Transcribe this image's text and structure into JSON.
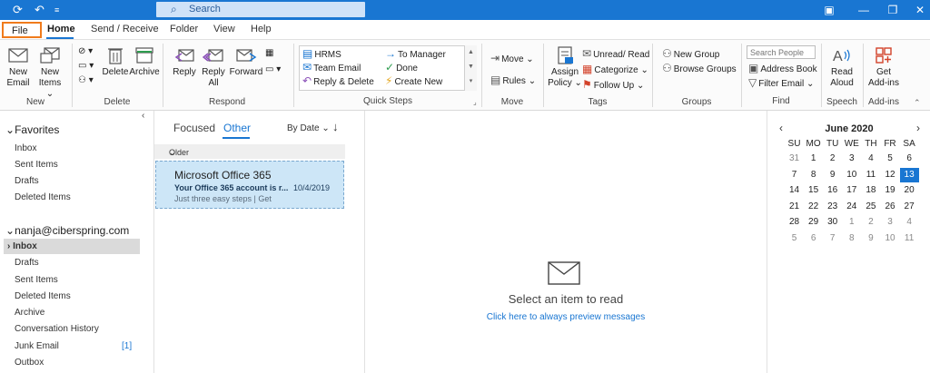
{
  "titlebar": {
    "search_label": "Search",
    "icons": [
      "sync-icon",
      "undo-icon",
      "customize-quick-access-icon",
      "search-icon",
      "ribbon-display-icon",
      "minimize-icon",
      "restore-icon",
      "close-icon"
    ]
  },
  "menu": {
    "tabs": [
      "File",
      "Home",
      "Send / Receive",
      "Folder",
      "View",
      "Help"
    ],
    "selected": "Home"
  },
  "ribbon": {
    "new": {
      "new_email": [
        "New",
        "Email"
      ],
      "new_items": [
        "New",
        "Items ⌄"
      ],
      "group": "New"
    },
    "delete": {
      "delete": "Delete",
      "archive": "Archive",
      "group": "Delete"
    },
    "respond": {
      "reply": "Reply",
      "reply_all": [
        "Reply",
        "All"
      ],
      "forward": "Forward",
      "group": "Respond"
    },
    "quick_steps": {
      "left": [
        "HRMS",
        "Team Email",
        "Reply & Delete"
      ],
      "right": [
        "To Manager",
        "Done",
        "Create New"
      ],
      "group": "Quick Steps"
    },
    "move": {
      "move": "Move ⌄",
      "rules": "Rules ⌄",
      "group": "Move"
    },
    "tags": {
      "assign_policy": [
        "Assign",
        "Policy ⌄"
      ],
      "unread_read": "Unread/ Read",
      "categorize": "Categorize ⌄",
      "follow_up": "Follow Up ⌄",
      "group": "Tags"
    },
    "groups": {
      "new_group": "New Group",
      "browse_groups": "Browse Groups",
      "group": "Groups"
    },
    "find": {
      "search_people_placeholder": "Search People",
      "address_book": "Address Book",
      "filter_email": "Filter Email ⌄",
      "group": "Find"
    },
    "speech": {
      "read_aloud": [
        "Read",
        "Aloud"
      ],
      "group": "Speech"
    },
    "addins": {
      "get_addins": [
        "Get",
        "Add-ins"
      ],
      "group": "Add-ins"
    }
  },
  "folders": {
    "favorites_header": "Favorites",
    "favorites": [
      "Inbox",
      "Sent Items",
      "Drafts",
      "Deleted Items"
    ],
    "account": "nanja@ciberspring.com",
    "account_folders": [
      "Inbox",
      "Drafts",
      "Sent Items",
      "Deleted Items",
      "Archive",
      "Conversation History",
      "Junk Email",
      "Outbox"
    ],
    "selected": "Inbox",
    "junk_count": "[1]"
  },
  "messages": {
    "tabs": {
      "focused": "Focused",
      "other": "Other"
    },
    "sort": "By Date ⌄",
    "sort_direction": "↓",
    "group_label": "Older",
    "items": [
      {
        "sender": "Microsoft Office 365",
        "subject": "Your Office 365 account is r...",
        "date": "10/4/2019",
        "preview": "Just three easy steps | Get"
      }
    ]
  },
  "reading": {
    "title": "Select an item to read",
    "link": "Click here to always preview messages"
  },
  "calendar": {
    "month": "June 2020",
    "dow": [
      "SU",
      "MO",
      "TU",
      "WE",
      "TH",
      "FR",
      "SA"
    ],
    "weeks": [
      [
        "31",
        "1",
        "2",
        "3",
        "4",
        "5",
        "6"
      ],
      [
        "7",
        "8",
        "9",
        "10",
        "11",
        "12",
        "13"
      ],
      [
        "14",
        "15",
        "16",
        "17",
        "18",
        "19",
        "20"
      ],
      [
        "21",
        "22",
        "23",
        "24",
        "25",
        "26",
        "27"
      ],
      [
        "28",
        "29",
        "30",
        "1",
        "2",
        "3",
        "4"
      ],
      [
        "5",
        "6",
        "7",
        "8",
        "9",
        "10",
        "11"
      ]
    ],
    "today": "13",
    "colors": {
      "accent": "#1976d2"
    }
  },
  "colors": {
    "titlebar": "#1976d2",
    "file_highlight": "#f07b1c",
    "selected_message": "#cde6f7"
  }
}
